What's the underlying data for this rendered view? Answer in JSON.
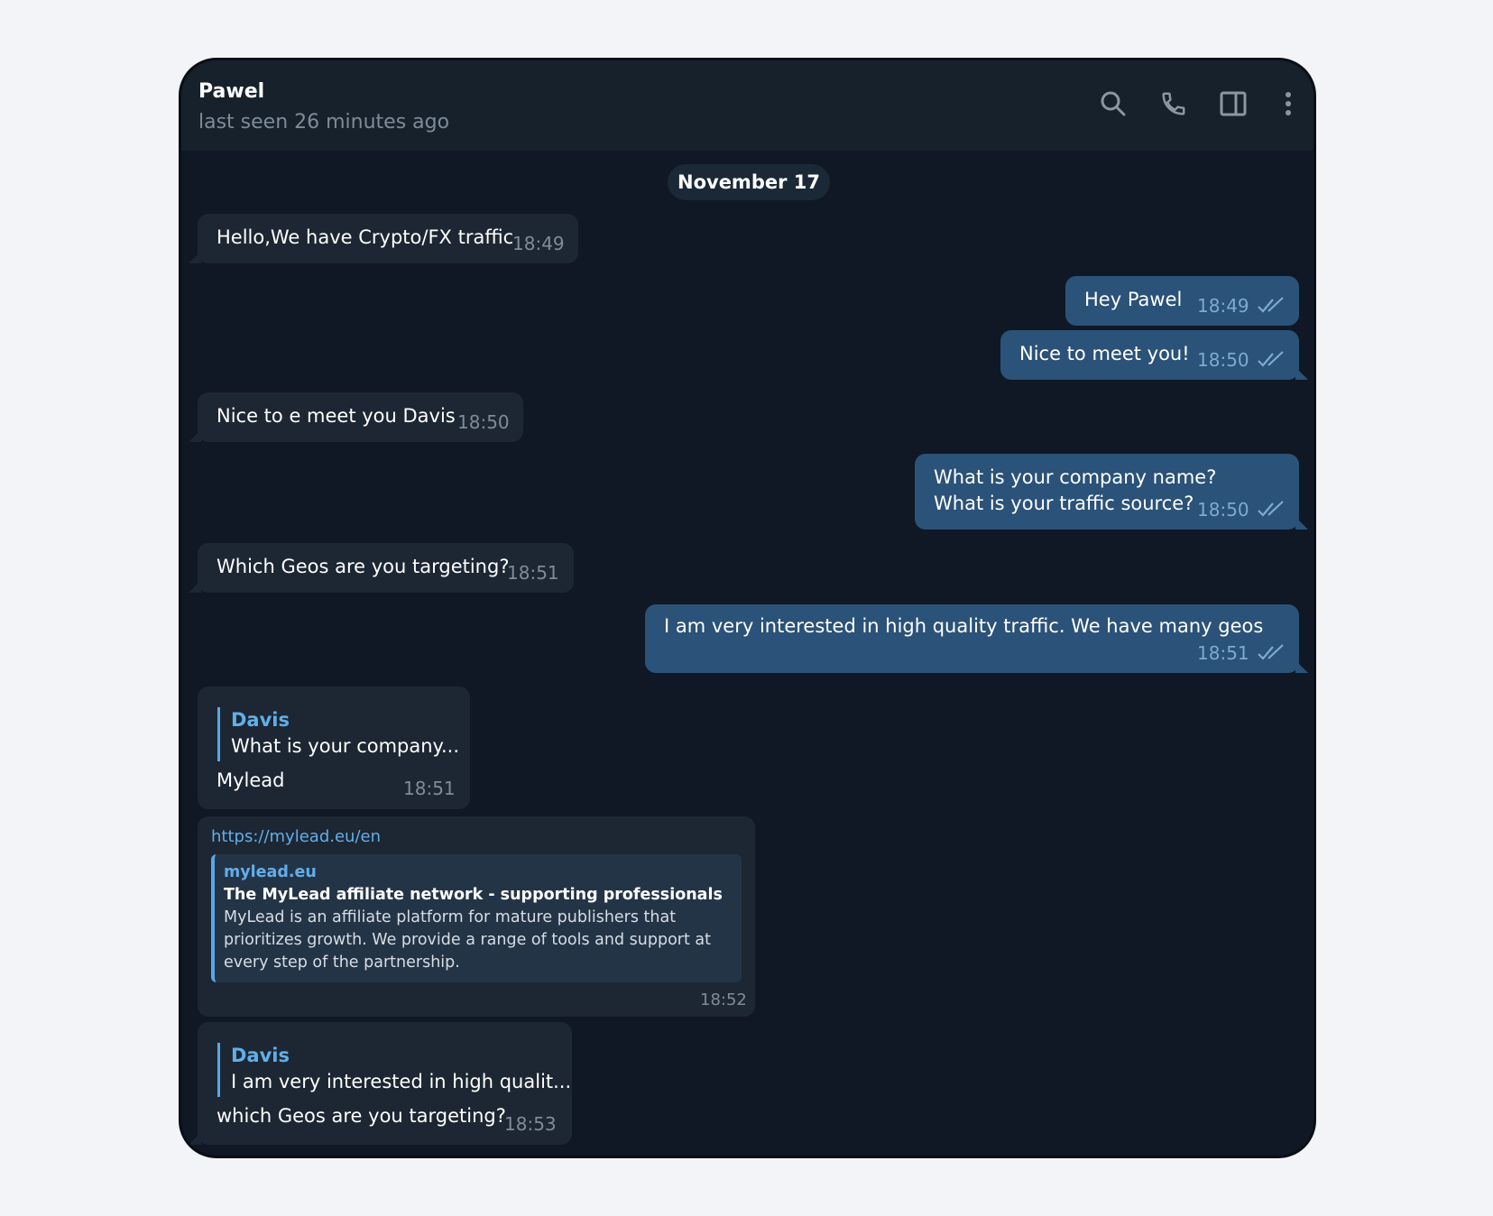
{
  "header": {
    "name": "Pawel",
    "status": "last seen 26 minutes ago",
    "icons": [
      "search-icon",
      "phone-icon",
      "sidebar-toggle-icon",
      "more-vertical-icon"
    ]
  },
  "date_separator": "November 17",
  "messages": [
    {
      "direction": "in",
      "text": "Hello,We have Crypto/FX traffic",
      "time": "18:49"
    },
    {
      "direction": "out",
      "text": "Hey Pawel",
      "time": "18:49",
      "read": true
    },
    {
      "direction": "out",
      "text": "Nice to meet you!",
      "time": "18:50",
      "read": true
    },
    {
      "direction": "in",
      "text": "Nice to e meet you Davis",
      "time": "18:50"
    },
    {
      "direction": "out",
      "text_lines": [
        "What is your company name?",
        "What is your traffic source?"
      ],
      "time": "18:50",
      "read": true
    },
    {
      "direction": "in",
      "text": "Which Geos are you targeting?",
      "time": "18:51"
    },
    {
      "direction": "out",
      "text": "I am very interested in high quality traffic. We have many geos",
      "time": "18:51",
      "read": true
    },
    {
      "direction": "in",
      "reply_to": {
        "name": "Davis",
        "text": "What is your company..."
      },
      "text": "Mylead",
      "time": "18:51"
    },
    {
      "direction": "in",
      "link": "https://mylead.eu/en",
      "preview": {
        "site": "mylead.eu",
        "title": "The MyLead affiliate network - supporting professionals",
        "description_lines": [
          "MyLead is an affiliate platform for mature publishers that",
          "prioritizes growth. We provide a range of tools and support at",
          "every step of the partnership."
        ]
      },
      "time": "18:52"
    },
    {
      "direction": "in",
      "reply_to": {
        "name": "Davis",
        "text": "I am very interested in high qualit..."
      },
      "text": "which Geos are you targeting?",
      "time": "18:53"
    }
  ],
  "colors": {
    "background": "#0f1824",
    "header": "#17212b",
    "incoming_bubble": "#1c2733",
    "outgoing_bubble": "#2b5278",
    "accent": "#62aee9"
  }
}
